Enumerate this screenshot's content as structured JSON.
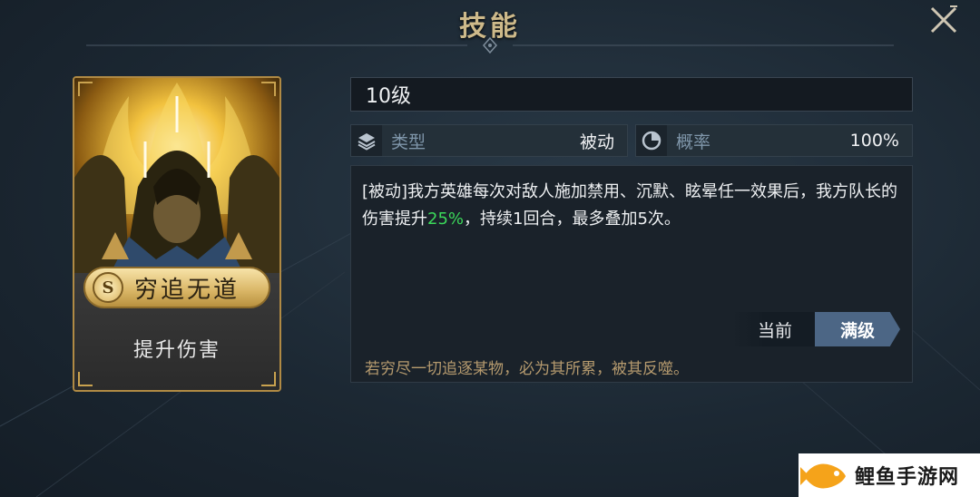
{
  "header": {
    "title": "技能"
  },
  "card": {
    "rank": "S",
    "skill_name": "穷追无道",
    "subtitle": "提升伤害"
  },
  "level": "10级",
  "info": {
    "type_label": "类型",
    "type_value": "被动",
    "type_icon": "layers-icon",
    "prob_label": "概率",
    "prob_value": "100%",
    "prob_icon": "pie-chart-icon"
  },
  "description": {
    "part1": "[被动]我方英雄每次对敌人施加禁用、沉默、眩晕任一效果后，我方队长的伤害提升",
    "highlight": "25%",
    "part2": "，持续1回合，最多叠加5次。"
  },
  "tabs": {
    "current": "当前",
    "max": "满级"
  },
  "flavor_text": "若穷尽一切追逐某物，必为其所累，被其反噬。",
  "watermark": {
    "text": "鲤鱼手游网"
  },
  "colors": {
    "highlight": "#3bd85a",
    "accent_gold": "#cdb98a",
    "tab_active": "#4c6685"
  }
}
